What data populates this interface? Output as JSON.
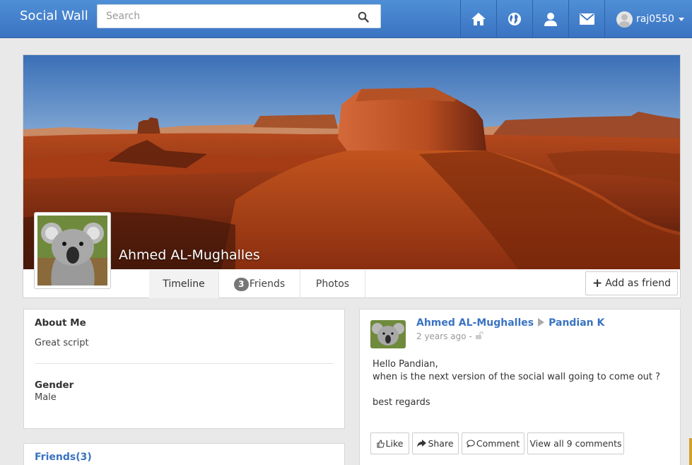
{
  "app": {
    "brand": "Social Wall"
  },
  "search": {
    "placeholder": "Search"
  },
  "nav": {
    "username": "raj0550"
  },
  "profile": {
    "name": "Ahmed AL-Mughalles",
    "tabs": {
      "timeline": "Timeline",
      "friends_count": "3",
      "friends": "Friends",
      "photos": "Photos"
    },
    "add_friend_label": "Add as friend"
  },
  "about": {
    "title": "About Me",
    "bio": "Great script",
    "gender_label": "Gender",
    "gender_value": "Male"
  },
  "friends_card": {
    "title": "Friends(3)"
  },
  "post": {
    "author": "Ahmed AL-Mughalles",
    "recipient": "Pandian K",
    "time": "2 years ago",
    "separator": "-",
    "lines": [
      "Hello Pandian,",
      "when is the next version of the social wall going to come out ?",
      "",
      "best regards"
    ],
    "actions": {
      "like": "Like",
      "share": "Share",
      "comment": "Comment",
      "view_all": "View all 9 comments"
    }
  }
}
